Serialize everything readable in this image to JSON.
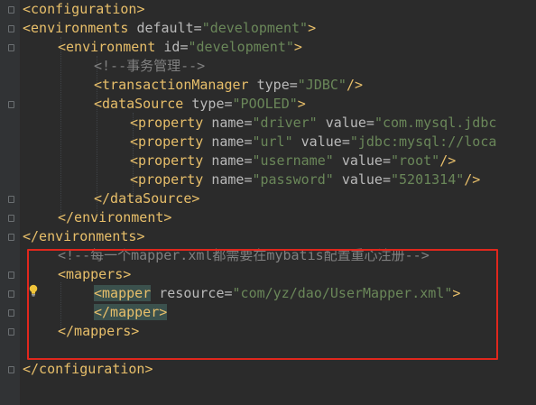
{
  "lines": [
    "<configuration>",
    "<environments default=\"development\">",
    "<environment id=\"development\">",
    "<!--事务管理-->",
    "<transactionManager type=\"JDBC\"/>",
    "<dataSource type=\"POOLED\">",
    "<property name=\"driver\" value=\"com.mysql.jdbc",
    "<property name=\"url\" value=\"jdbc:mysql://loca",
    "<property name=\"username\" value=\"root\"/>",
    "<property name=\"password\" value=\"5201314\"/>",
    "</dataSource>",
    "</environment>",
    "</environments>",
    "<!--每一个mapper.xml都需要在mybatis配置重心注册-->",
    "<mappers>",
    "<mapper resource=\"com/yz/dao/UserMapper.xml\">",
    "</mapper>",
    "</mappers>",
    "",
    "</configuration>"
  ],
  "colors": {
    "background": "#2b2b2b",
    "tag": "#e8bf6a",
    "attribute": "#bababa",
    "string": "#6a8759",
    "comment": "#808080",
    "highlight_box": "#e0271d"
  },
  "icons": [
    "lightbulb-icon",
    "fold-marker-icon"
  ]
}
